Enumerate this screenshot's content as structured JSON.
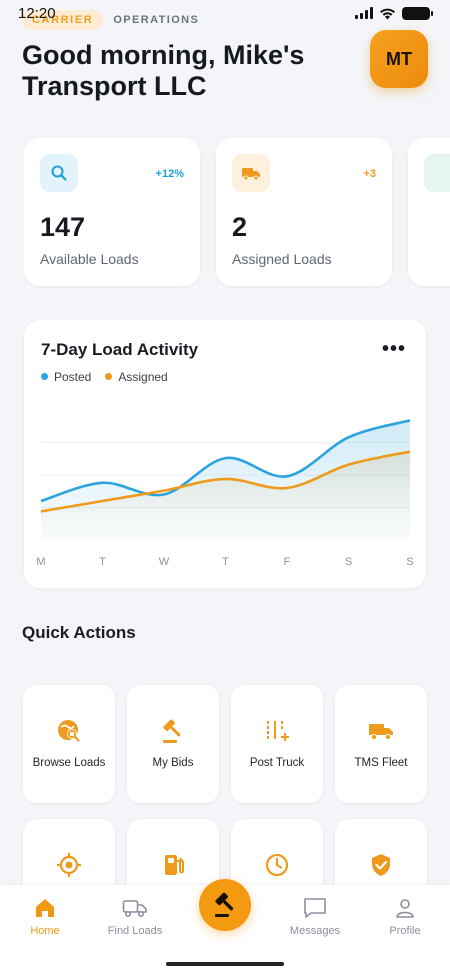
{
  "status_bar": {
    "time": "12:20"
  },
  "header": {
    "role_tag": "CARRIER",
    "section_tag": "OPERATIONS",
    "greeting": "Good morning, Mike's Transport LLC",
    "avatar_initials": "MT"
  },
  "stats": [
    {
      "icon": "search-icon",
      "delta": "+12%",
      "value": "147",
      "label": "Available Loads",
      "accent": "#1d9fd8",
      "icon_bg": "#e3f3fb"
    },
    {
      "icon": "truck-icon",
      "delta": "+3",
      "value": "2",
      "label": "Assigned Loads",
      "accent": "#ee9a1c",
      "icon_bg": "#fdf0dc"
    }
  ],
  "chart": {
    "title": "7-Day Load Activity",
    "more_label": "•••"
  },
  "chart_data": {
    "type": "area",
    "categories": [
      "M",
      "T",
      "W",
      "T",
      "F",
      "S",
      "S"
    ],
    "series": [
      {
        "name": "Posted",
        "values": [
          30,
          44,
          35,
          63,
          49,
          79,
          92
        ],
        "color": "#2aa3de"
      },
      {
        "name": "Assigned",
        "values": [
          22,
          30,
          38,
          47,
          40,
          58,
          68
        ],
        "color": "#ee9a1c"
      }
    ],
    "ylim": [
      0,
      100
    ],
    "grid": true,
    "legend": "top-left"
  },
  "quick_actions": {
    "title": "Quick Actions",
    "items": [
      {
        "label": "Browse Loads",
        "icon": "browse-loads-icon"
      },
      {
        "label": "My Bids",
        "icon": "gavel-icon"
      },
      {
        "label": "Post Truck",
        "icon": "post-truck-icon"
      },
      {
        "label": "TMS Fleet",
        "icon": "truck-icon"
      },
      {
        "label": "",
        "icon": "target-icon"
      },
      {
        "label": "",
        "icon": "fuel-icon"
      },
      {
        "label": "",
        "icon": "clock-icon"
      },
      {
        "label": "",
        "icon": "shield-check-icon"
      }
    ]
  },
  "nav": {
    "items": [
      {
        "label": "Home",
        "icon": "home-icon",
        "active": true
      },
      {
        "label": "Find Loads",
        "icon": "truck-icon",
        "active": false
      },
      {
        "label": "",
        "icon": "gavel-icon",
        "active": false
      },
      {
        "label": "Messages",
        "icon": "message-icon",
        "active": false
      },
      {
        "label": "Profile",
        "icon": "user-icon",
        "active": false
      }
    ]
  },
  "colors": {
    "accent": "#f39a11",
    "blue": "#2aa3de",
    "background": "#f3f5f8"
  }
}
